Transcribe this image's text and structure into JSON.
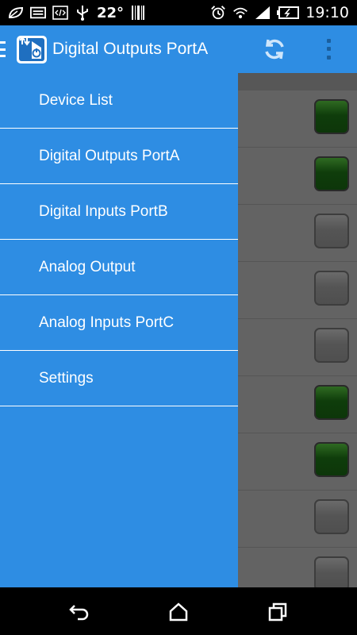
{
  "status_bar": {
    "temperature": "22°",
    "time": "19:10",
    "left_icons": [
      "leaf-icon",
      "image-icon",
      "code-icon",
      "usb-icon"
    ],
    "right_icons": [
      "barcode-icon",
      "alarm-icon",
      "wifi-icon",
      "signal-icon",
      "battery-icon"
    ]
  },
  "appbar": {
    "title": "Digital Outputs PortA",
    "icons": [
      "menu-icon",
      "app-logo-icon",
      "refresh-icon",
      "overflow-menu-icon"
    ]
  },
  "drawer": {
    "items": [
      {
        "label": "Device List"
      },
      {
        "label": "Digital Outputs PortA"
      },
      {
        "label": "Digital Inputs PortB"
      },
      {
        "label": "Analog Output"
      },
      {
        "label": "Analog Inputs PortC"
      },
      {
        "label": "Settings"
      }
    ]
  },
  "outputs": {
    "states": [
      true,
      true,
      false,
      false,
      false,
      true,
      true,
      false,
      false
    ]
  },
  "colors": {
    "accent": "#2e8de3",
    "led_on": "#0f3d0b",
    "led_off": "#555555",
    "dim_background": "#636363"
  },
  "navbar": {
    "icons": [
      "back-icon",
      "home-icon",
      "recents-icon"
    ]
  }
}
